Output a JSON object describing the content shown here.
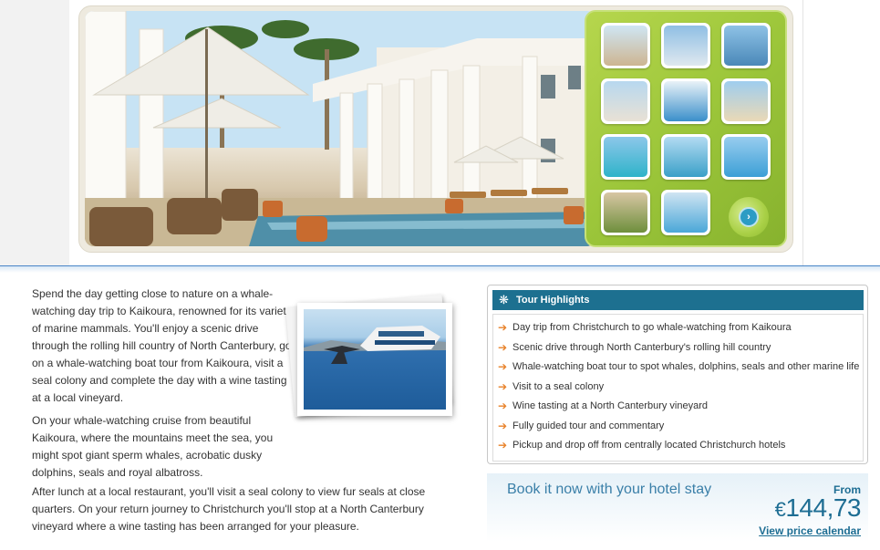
{
  "colors": {
    "header_blue": "#1d7090",
    "accent_orange": "#e8822a",
    "panel_green": "#9cc63a",
    "price_blue": "#1d6d93",
    "book_title_blue": "#3a7fa8"
  },
  "gallery": {
    "thumbnails": [
      {
        "name": "thumb-hotel-terrace",
        "top": "#cfe6f4",
        "bottom": "#cdb591"
      },
      {
        "name": "thumb-tower-blue",
        "top": "#8fbfe4",
        "bottom": "#dfe8ef"
      },
      {
        "name": "thumb-bridge",
        "top": "#8ec2e6",
        "bottom": "#4a88b8"
      },
      {
        "name": "thumb-highrise",
        "top": "#b7d8ef",
        "bottom": "#e9e1d5"
      },
      {
        "name": "thumb-lifebuoy",
        "top": "#e9f2f8",
        "bottom": "#3a8fca"
      },
      {
        "name": "thumb-palm-beach",
        "top": "#9fcdee",
        "bottom": "#ead9b6"
      },
      {
        "name": "thumb-lagoon",
        "top": "#8cc7ea",
        "bottom": "#2fb3c9"
      },
      {
        "name": "thumb-island",
        "top": "#b3dbf2",
        "bottom": "#3aa0c8"
      },
      {
        "name": "thumb-resort-pool",
        "top": "#98cdef",
        "bottom": "#3c9fd6"
      },
      {
        "name": "thumb-garden",
        "top": "#d8c6a4",
        "bottom": "#6e8f3c"
      },
      {
        "name": "thumb-pool-deck",
        "top": "#cfe4f2",
        "bottom": "#4aa7d8"
      }
    ],
    "next_icon": "chevron-right-icon"
  },
  "description": {
    "p1": "Spend the day getting close to nature on a whale-watching day trip to Kaikoura, renowned for its variety of marine mammals. You'll enjoy a scenic drive through the rolling hill country of North Canterbury, go on a whale-watching boat tour from Kaikoura, visit a seal colony and complete the day with a wine tasting at a local vineyard.",
    "p2": "On your whale-watching cruise from beautiful Kaikoura, where the mountains meet the sea, you might spot giant sperm whales, acrobatic dusky dolphins, seals and royal albatross.",
    "p3": "After lunch at a local restaurant, you'll visit a seal colony to view fur seals at close quarters. On your return journey to Christchurch you'll stop at a North Canterbury vineyard where a wine tasting has been arranged for your pleasure."
  },
  "highlights": {
    "title": "Tour Highlights",
    "icon": "snowflake-icon",
    "items": [
      "Day trip from Christchurch to go whale-watching from Kaikoura",
      "Scenic drive through North Canterbury's rolling hill country",
      "Whale-watching boat tour to spot whales, dolphins, seals and other marine life",
      "Visit to a seal colony",
      "Wine tasting at a North Canterbury vineyard",
      "Fully guided tour and commentary",
      "Pickup and drop off from centrally located Christchurch hotels"
    ]
  },
  "booking": {
    "title": "Book it now with your hotel stay",
    "from_label": "From",
    "currency": "€",
    "price": "144,73",
    "link_label": "View price calendar"
  }
}
